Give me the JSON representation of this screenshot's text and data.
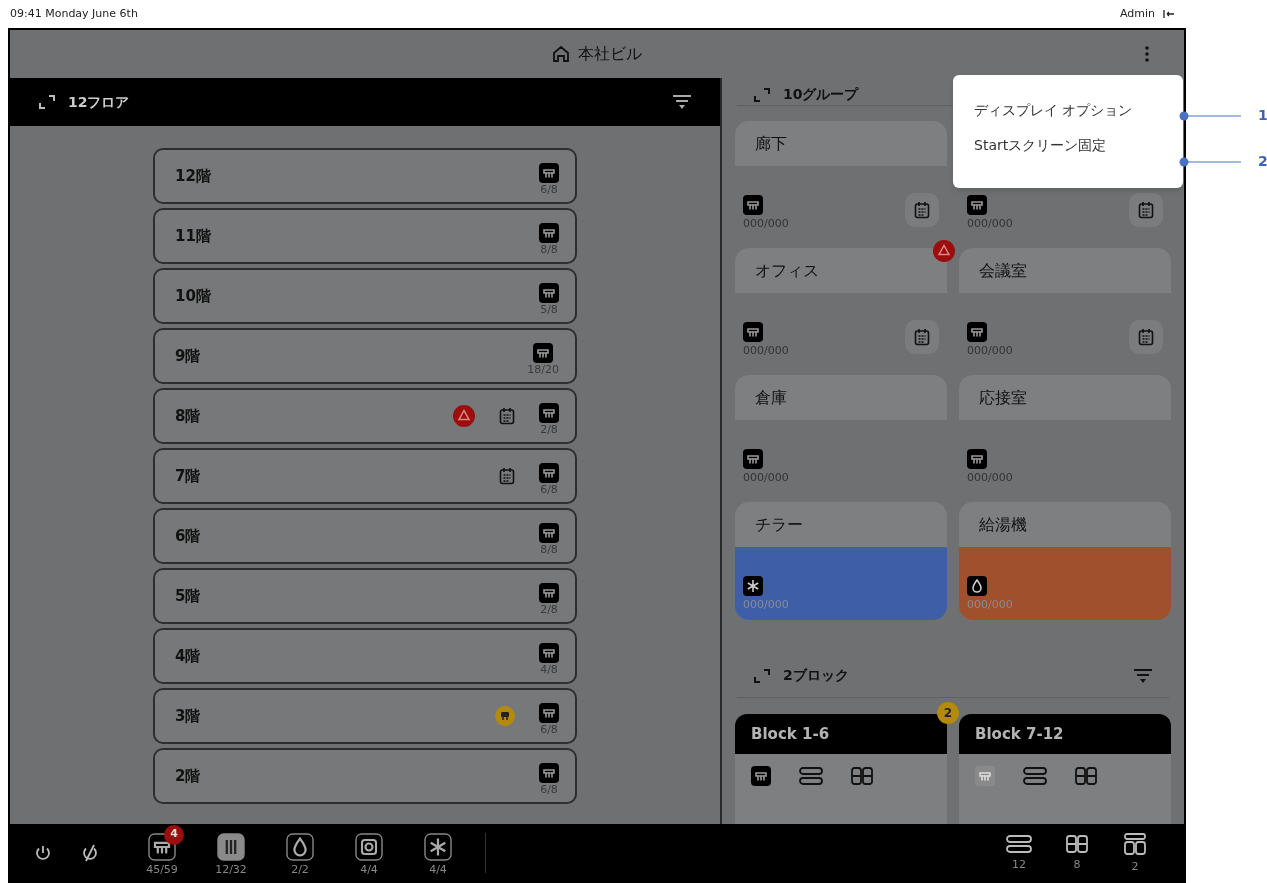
{
  "status_bar": {
    "datetime": "09:41 Monday June 6th",
    "user": "Admin"
  },
  "header": {
    "title": "本社ビル"
  },
  "floors_panel": {
    "title": "12フロア",
    "floors": [
      {
        "name": "12階",
        "alarm": false,
        "schedule": false,
        "service": false,
        "count": "6/8"
      },
      {
        "name": "11階",
        "alarm": false,
        "schedule": false,
        "service": false,
        "count": "8/8"
      },
      {
        "name": "10階",
        "alarm": false,
        "schedule": false,
        "service": false,
        "count": "5/8"
      },
      {
        "name": "9階",
        "alarm": false,
        "schedule": false,
        "service": false,
        "count": "18/20"
      },
      {
        "name": "8階",
        "alarm": true,
        "schedule": true,
        "service": false,
        "count": "2/8"
      },
      {
        "name": "7階",
        "alarm": false,
        "schedule": true,
        "service": false,
        "count": "6/8"
      },
      {
        "name": "6階",
        "alarm": false,
        "schedule": false,
        "service": false,
        "count": "8/8"
      },
      {
        "name": "5階",
        "alarm": false,
        "schedule": false,
        "service": false,
        "count": "2/8"
      },
      {
        "name": "4階",
        "alarm": false,
        "schedule": false,
        "service": false,
        "count": "4/8"
      },
      {
        "name": "3階",
        "alarm": false,
        "schedule": false,
        "service": true,
        "count": "6/8"
      },
      {
        "name": "2階",
        "alarm": false,
        "schedule": false,
        "service": false,
        "count": "6/8"
      }
    ]
  },
  "groups_panel": {
    "title": "10グループ",
    "groups": [
      {
        "name": "廊下",
        "kind": "ac",
        "count": "000/000",
        "schedule": true,
        "alarm": false
      },
      {
        "kind": "ac",
        "count": "000/000",
        "schedule": true,
        "alarm": false
      },
      {
        "name": "オフィス",
        "kind": "ac",
        "count": "000/000",
        "schedule": true,
        "alarm": true
      },
      {
        "name": "会議室",
        "kind": "ac",
        "count": "000/000",
        "schedule": true,
        "alarm": false
      },
      {
        "name": "倉庫",
        "kind": "ac",
        "count": "000/000",
        "schedule": false,
        "alarm": false
      },
      {
        "name": "応接室",
        "kind": "ac",
        "count": "000/000",
        "schedule": false,
        "alarm": false
      },
      {
        "name": "チラー",
        "kind": "chiller",
        "color": "#3f5ea8",
        "count": "000/000",
        "schedule": false,
        "alarm": false
      },
      {
        "name": "給湯機",
        "kind": "boiler",
        "color": "#a0502c",
        "count": "000/000",
        "schedule": false,
        "alarm": false
      }
    ]
  },
  "blocks_panel": {
    "title": "2ブロック",
    "blocks": [
      {
        "name": "Block 1-6",
        "badge": "2",
        "ac_disabled": false
      },
      {
        "name": "Block 7-12",
        "ac_disabled": true
      }
    ]
  },
  "menu": {
    "items": [
      "ディスプレイ オプション",
      "Startスクリーン固定"
    ]
  },
  "callouts": [
    "1",
    "2"
  ],
  "bottom_bar": {
    "devices": [
      {
        "kind": "ac",
        "count": "45/59",
        "badge": "4",
        "selected": false
      },
      {
        "kind": "vent",
        "count": "12/32",
        "selected": true
      },
      {
        "kind": "water",
        "count": "2/2",
        "selected": false
      },
      {
        "kind": "unit",
        "count": "4/4",
        "selected": false
      },
      {
        "kind": "snow",
        "count": "4/4",
        "selected": false
      }
    ],
    "views": [
      {
        "kind": "floors",
        "count": "12"
      },
      {
        "kind": "groups",
        "count": "8"
      },
      {
        "kind": "blocks",
        "count": "2"
      }
    ]
  }
}
